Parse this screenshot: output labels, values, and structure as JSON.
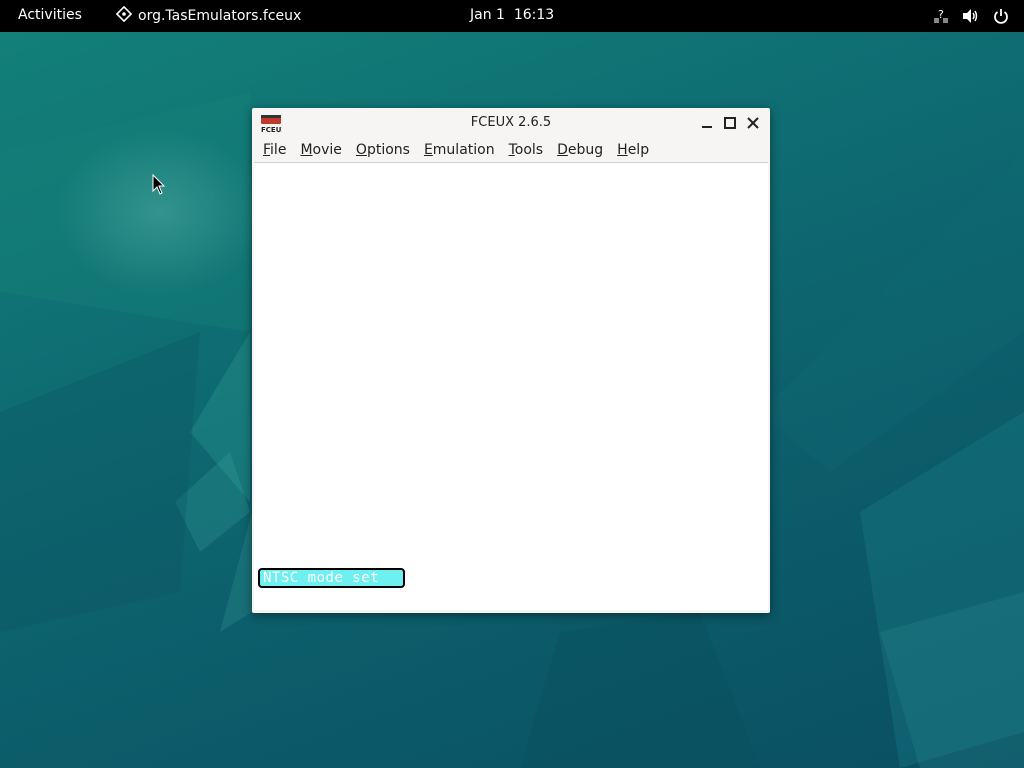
{
  "topbar": {
    "activities_label": "Activities",
    "app_name": "org.TasEmulators.fceux",
    "clock": "Jan 1  16:13",
    "tray_icons": [
      "network-unknown-icon",
      "volume-icon",
      "power-icon"
    ]
  },
  "window": {
    "title": "FCEUX 2.6.5",
    "app_icon_text": "FCEUX",
    "menus": [
      {
        "label": "File",
        "mnemonic": "F"
      },
      {
        "label": "Movie",
        "mnemonic": "M"
      },
      {
        "label": "Options",
        "mnemonic": "O"
      },
      {
        "label": "Emulation",
        "mnemonic": "E"
      },
      {
        "label": "Tools",
        "mnemonic": "T"
      },
      {
        "label": "Debug",
        "mnemonic": "D"
      },
      {
        "label": "Help",
        "mnemonic": "H"
      }
    ],
    "osd_message": "NTSC mode set"
  },
  "colors": {
    "topbar_bg": "#000000",
    "desktop_teal": "#0f6f73",
    "osd_bg": "#6ef0f0"
  }
}
